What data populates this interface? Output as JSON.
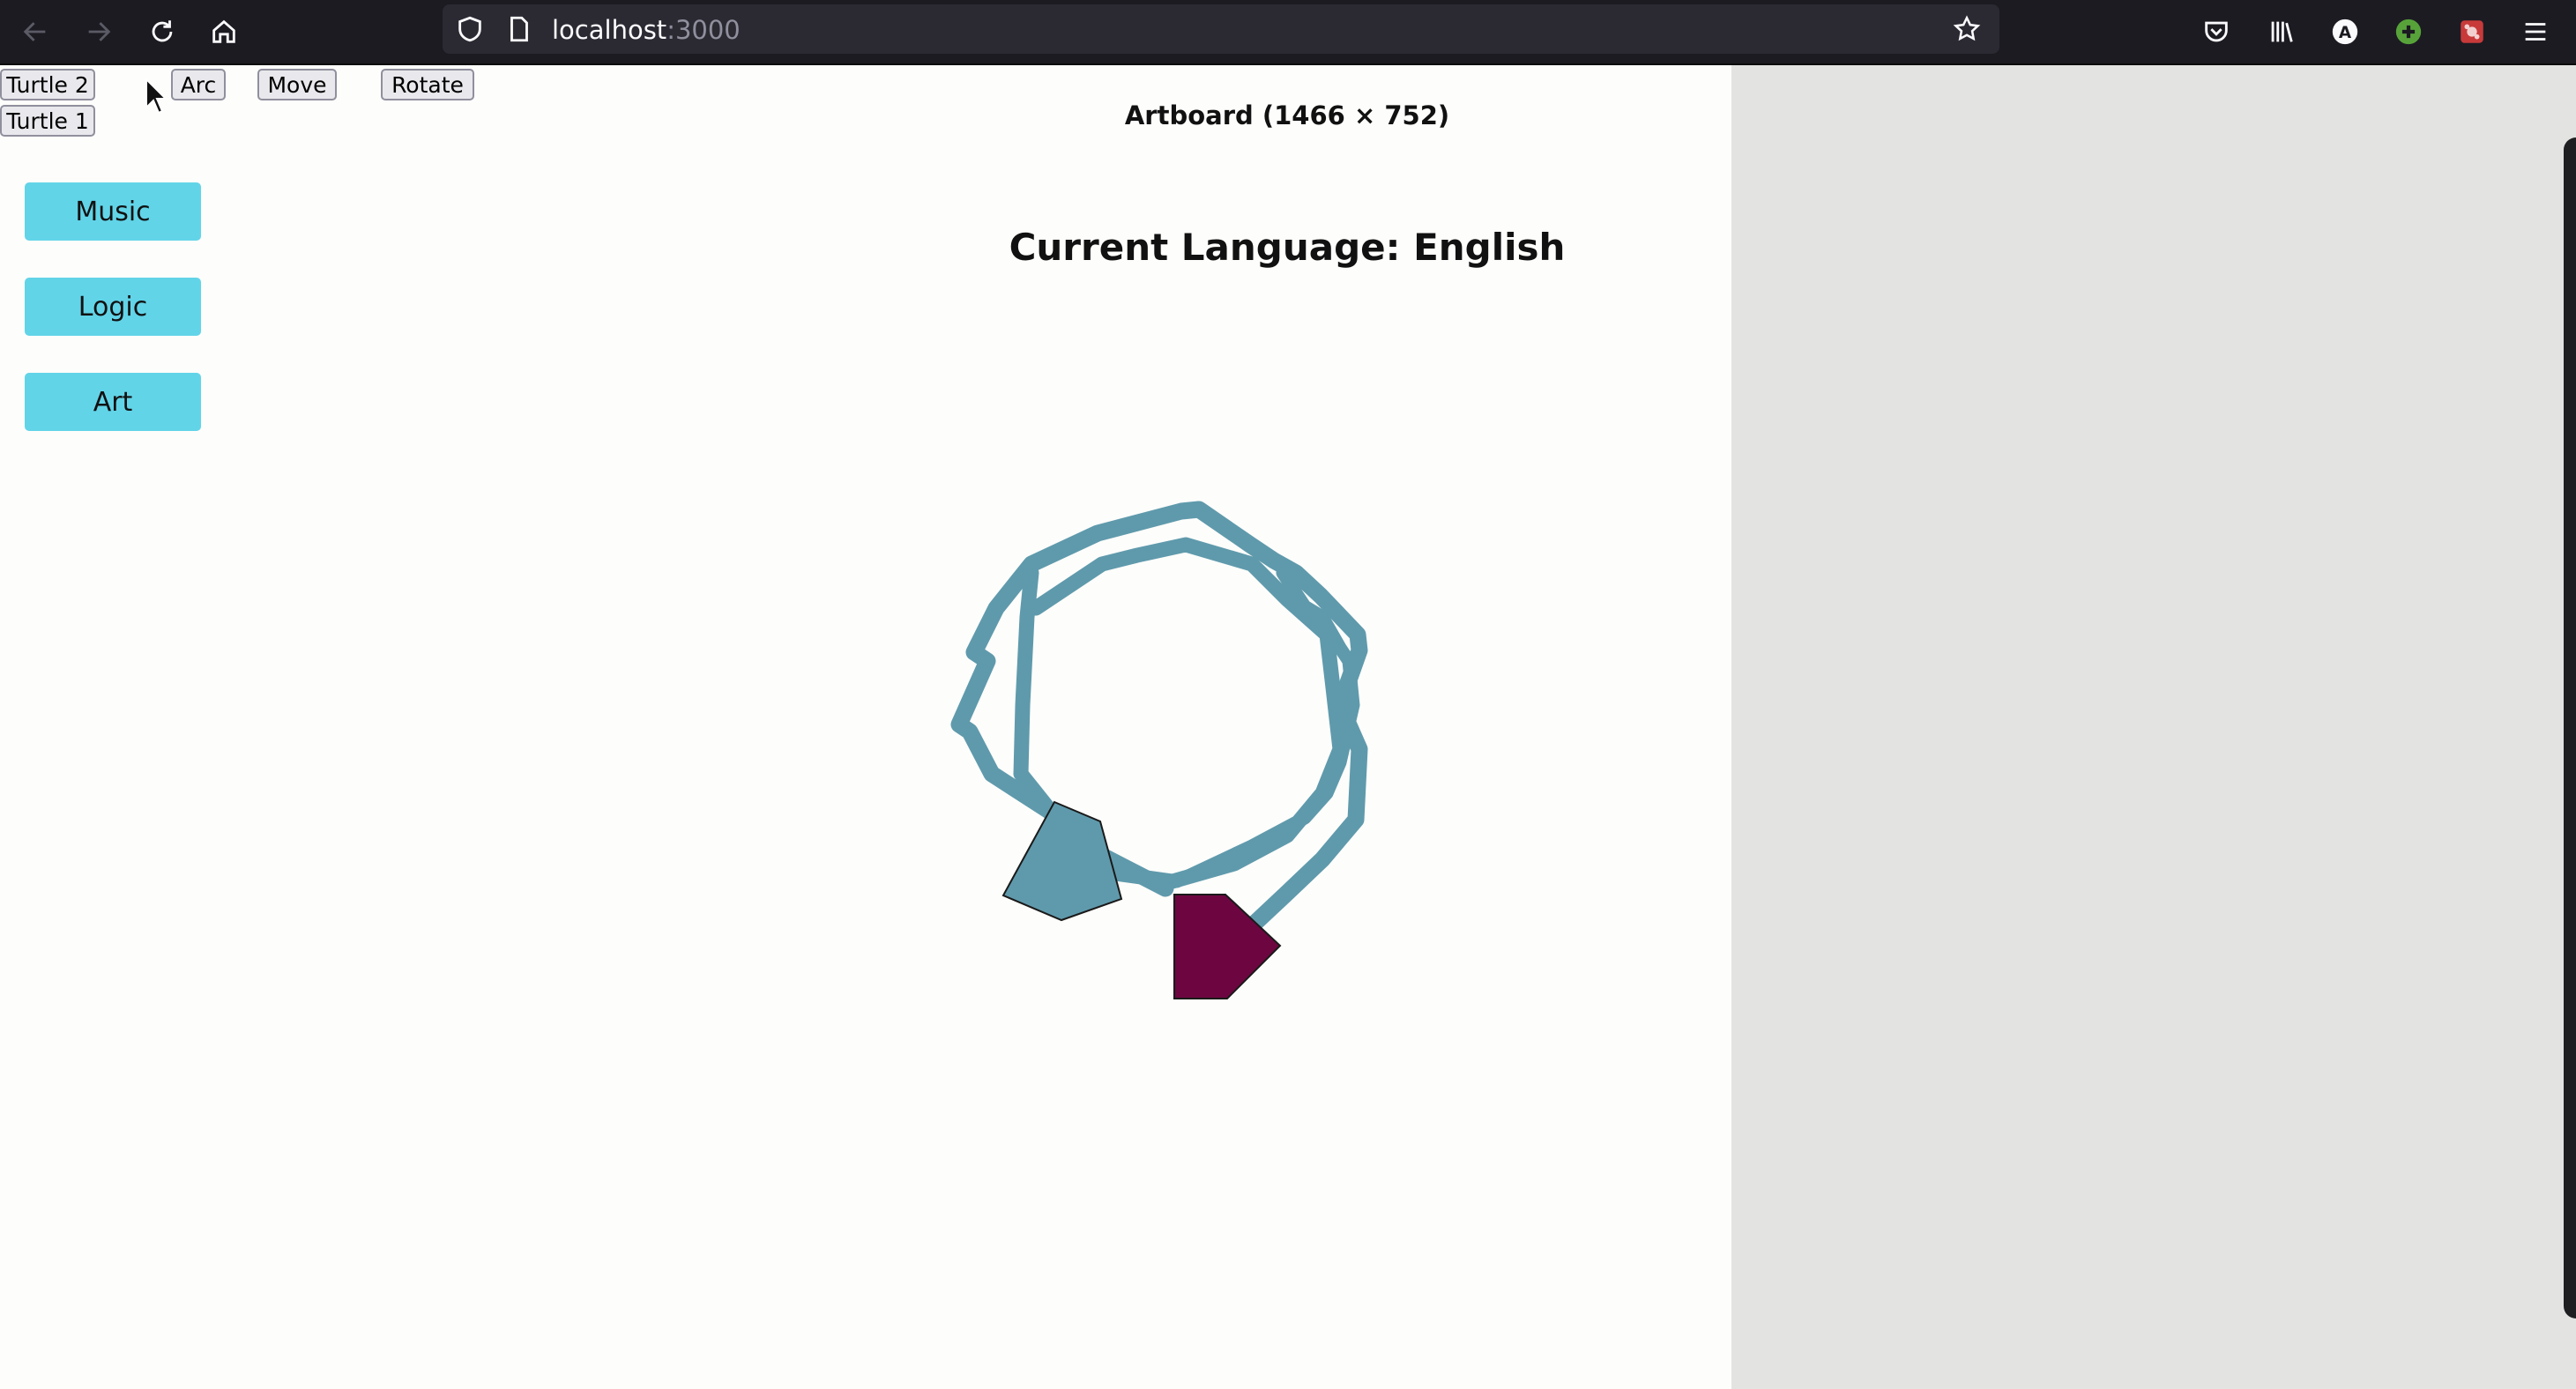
{
  "browser": {
    "url_host": "localhost",
    "url_port": ":3000",
    "colors": {
      "chrome_bg": "#1c1b22",
      "url_field_bg": "#2b2a33"
    },
    "icons": [
      "back-arrow-icon",
      "forward-arrow-icon",
      "reload-icon",
      "home-icon",
      "shield-icon",
      "page-icon",
      "bookmark-star-icon",
      "pocket-icon",
      "library-icon",
      "account-icon",
      "extension-add-icon",
      "extension-puzzle-icon",
      "hamburger-menu-icon"
    ]
  },
  "toolbar": {
    "turtle2_label": "Turtle 2",
    "turtle1_label": "Turtle 1",
    "arc_label": "Arc",
    "move_label": "Move",
    "rotate_label": "Rotate"
  },
  "categories": {
    "music_label": "Music",
    "logic_label": "Logic",
    "art_label": "Art",
    "color": "#62d4e8"
  },
  "artboard": {
    "title": "Artboard (1466 × 752)",
    "language_heading": "Current Language: English"
  },
  "turtles": [
    {
      "name": "Turtle 1",
      "color": "#5f9aac",
      "path_color": "#5f9aac"
    },
    {
      "name": "Turtle 2",
      "color": "#6d0640"
    }
  ],
  "colors": {
    "artboard_bg": "#fdfdfb",
    "side_panel_bg": "#e3e4e1"
  }
}
